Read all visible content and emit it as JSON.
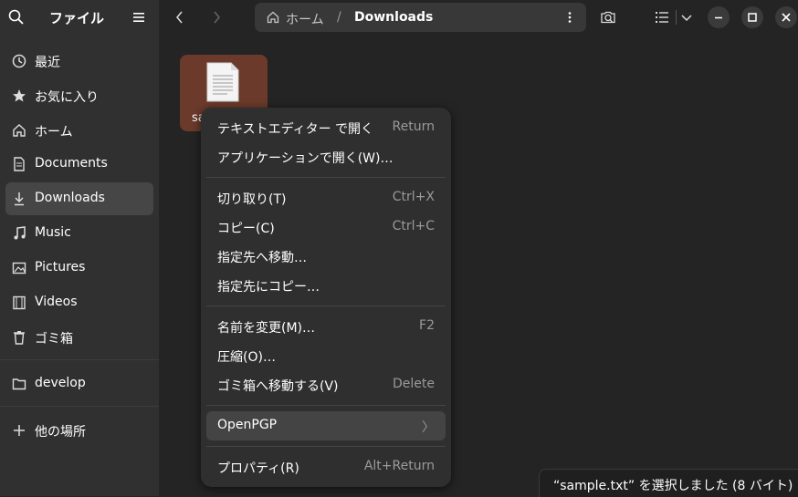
{
  "sidebar": {
    "title": "ファイル",
    "items": [
      {
        "label": "最近",
        "icon": "clock-icon"
      },
      {
        "label": "お気に入り",
        "icon": "star-icon"
      },
      {
        "label": "ホーム",
        "icon": "home-icon"
      },
      {
        "label": "Documents",
        "icon": "document-icon"
      },
      {
        "label": "Downloads",
        "icon": "download-icon"
      },
      {
        "label": "Music",
        "icon": "music-icon"
      },
      {
        "label": "Pictures",
        "icon": "picture-icon"
      },
      {
        "label": "Videos",
        "icon": "video-icon"
      },
      {
        "label": "ゴミ箱",
        "icon": "trash-icon"
      },
      {
        "label": "develop",
        "icon": "folder-icon"
      },
      {
        "label": "他の場所",
        "icon": "plus-icon"
      }
    ],
    "active": "Downloads"
  },
  "header": {
    "path_home": "ホーム",
    "path_separator": "/",
    "path_current": "Downloads"
  },
  "file": {
    "name": "sa"
  },
  "context_menu": {
    "open_text_editor": {
      "label": "テキストエディター で開く",
      "accel": "Return"
    },
    "open_with": {
      "label": "アプリケーションで開く(W)…"
    },
    "cut": {
      "label": "切り取り(T)",
      "accel": "Ctrl+X"
    },
    "copy": {
      "label": "コピー(C)",
      "accel": "Ctrl+C"
    },
    "move_to": {
      "label": "指定先へ移動…"
    },
    "copy_to": {
      "label": "指定先にコピー…"
    },
    "rename": {
      "label": "名前を変更(M)…",
      "accel": "F2"
    },
    "compress": {
      "label": "圧縮(O)…"
    },
    "trash": {
      "label": "ゴミ箱へ移動する(V)",
      "accel": "Delete"
    },
    "openpgp": {
      "label": "OpenPGP",
      "accel": "〉"
    },
    "properties": {
      "label": "プロパティ(R)",
      "accel": "Alt+Return"
    }
  },
  "status": {
    "text": "“sample.txt” を選択しました (8 バイト)"
  },
  "colors": {
    "window_bg": "#242424",
    "sidebar_bg": "#303030",
    "selection": "#6b3a2a"
  }
}
